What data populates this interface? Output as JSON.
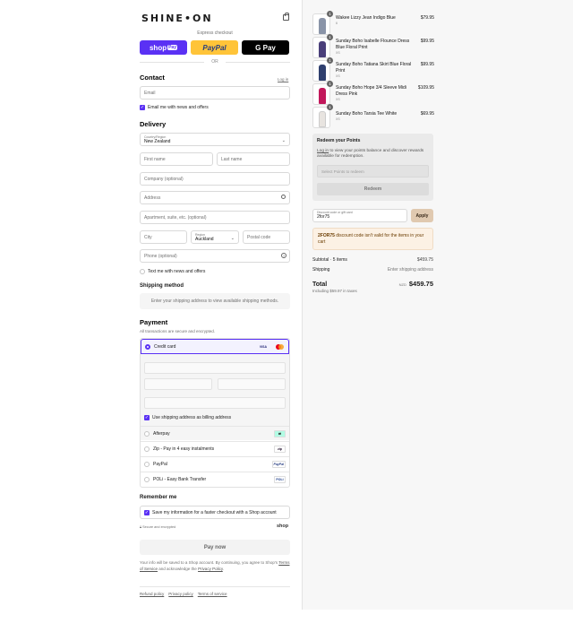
{
  "brand": "SHINE•ON",
  "express": {
    "label": "Express checkout",
    "shop_label": "shop",
    "shop_pay": "Pay",
    "paypal_label": "PayPal",
    "gpay_label": "G Pay",
    "or_label": "OR"
  },
  "contact": {
    "title": "Contact",
    "login_link": "Log in",
    "email_placeholder": "Email",
    "news_checkbox": "Email me with news and offers"
  },
  "delivery": {
    "title": "Delivery",
    "country_label": "Country/Region",
    "country_value": "New Zealand",
    "first_name": "First name",
    "last_name": "Last name",
    "company": "Company (optional)",
    "address": "Address",
    "apartment": "Apartment, suite, etc. (optional)",
    "city": "City",
    "region_label": "Region",
    "region_value": "Auckland",
    "postal": "Postal code",
    "phone": "Phone (optional)",
    "text_checkbox": "Text me with news and offers"
  },
  "shipping": {
    "title": "Shipping method",
    "message": "Enter your shipping address to view available shipping methods."
  },
  "payment": {
    "title": "Payment",
    "subtitle": "All transactions are secure and encrypted.",
    "credit_card": "Credit card",
    "visa": "VISA",
    "billing_checkbox": "Use shipping address as billing address",
    "methods": [
      {
        "label": "Afterpay",
        "logo": "afterpay-icon"
      },
      {
        "label": "Zip - Pay in 4 easy instalments",
        "logo": "zip"
      },
      {
        "label": "PayPal",
        "logo": "PayPal"
      },
      {
        "label": "POLi - Easy Bank Transfer",
        "logo": "POLi"
      }
    ]
  },
  "remember": {
    "title": "Remember me",
    "checkbox": "Save my information for a faster checkout with a Shop account",
    "secure": "Secure and encrypted",
    "shop_logo": "shop"
  },
  "pay_now": "Pay now",
  "legal": {
    "text1": "Your info will be saved to a Shop account. By continuing, you agree to Shop's ",
    "terms": "Terms of Service",
    "text2": " and acknowledge the ",
    "privacy": "Privacy Policy",
    "text3": "."
  },
  "footer": {
    "refund": "Refund policy",
    "privacy": "Privacy policy",
    "terms": "Terms of service"
  },
  "cart": {
    "items": [
      {
        "name": "Wakee Lizzy Jean Indigo Blue",
        "variant": "6",
        "price": "$79.95",
        "qty": "1",
        "color": "#8a94a8"
      },
      {
        "name": "Sunday Boho Isabelle Flounce Dress Blue Floral Print",
        "variant": "XS",
        "price": "$99.95",
        "qty": "1",
        "color": "#4a3f7a"
      },
      {
        "name": "Sunday Boho Tatiana Skirt Blue Floral Print",
        "variant": "XS",
        "price": "$99.95",
        "qty": "1",
        "color": "#2f3f6e"
      },
      {
        "name": "Sunday Boho Hope 3/4 Sleeve Midi Dress Pink",
        "variant": "XS",
        "price": "$109.95",
        "qty": "1",
        "color": "#c2185b"
      },
      {
        "name": "Sunday Boho Tarsia Tee White",
        "variant": "XS",
        "price": "$69.95",
        "qty": "1",
        "color": "#e8e4e0"
      }
    ],
    "redeem": {
      "title": "Redeem your Points",
      "login": "Log in",
      "text": " to view your points balance and discover rewards available for redemption.",
      "select_placeholder": "Select Points to redeem",
      "button": "Redeem"
    },
    "discount": {
      "label": "Discount code or gift card",
      "value": "2for75",
      "apply": "Apply"
    },
    "warning": {
      "code": "2FOR75",
      "text": " discount code isn't valid for the items in your cart"
    },
    "subtotal_label": "Subtotal · 5 items",
    "subtotal_value": "$459.75",
    "shipping_label": "Shipping",
    "shipping_value": "Enter shipping address",
    "total_label": "Total",
    "currency": "NZD",
    "total_value": "$459.75",
    "taxes": "Including $59.97 in taxes"
  },
  "colors": {
    "accent": "#5a31f4",
    "paypal": "#ffc439",
    "apply": "#e0c9b0",
    "warning_bg": "#fcf1e4"
  }
}
